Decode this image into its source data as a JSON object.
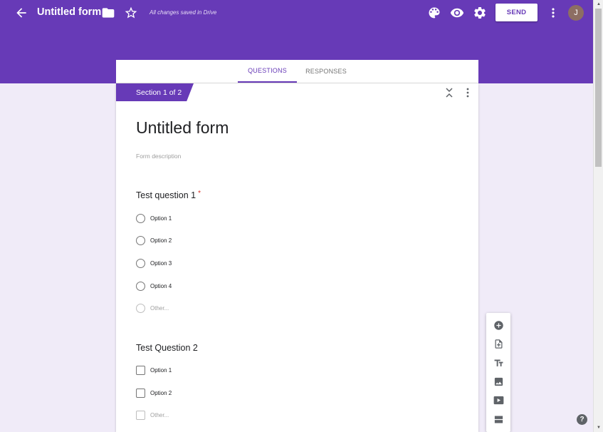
{
  "header": {
    "form_title": "Untitled form",
    "save_status": "All changes saved in Drive",
    "send_label": "SEND",
    "avatar_initial": "J",
    "icons": [
      "back-arrow-icon",
      "folder-icon",
      "star-icon",
      "palette-icon",
      "preview-eye-icon",
      "settings-gear-icon",
      "more-vert-icon"
    ]
  },
  "tabs": [
    {
      "label": "QUESTIONS",
      "active": true
    },
    {
      "label": "RESPONSES",
      "active": false
    }
  ],
  "section": {
    "label": "Section 1 of 2"
  },
  "form": {
    "title": "Untitled form",
    "description_placeholder": "Form description"
  },
  "questions": [
    {
      "title": "Test question 1",
      "required_mark": "*",
      "type": "multiple-choice",
      "options": [
        "Option 1",
        "Option 2",
        "Option 3",
        "Option 4"
      ],
      "other": "Other..."
    },
    {
      "title": "Test Question 2",
      "type": "checkboxes",
      "options": [
        "Option 1",
        "Option 2"
      ],
      "other": "Other..."
    }
  ],
  "toolbar": {
    "icons": [
      "add-question-icon",
      "import-questions-icon",
      "add-title-icon",
      "add-image-icon",
      "add-video-icon",
      "add-section-icon"
    ]
  },
  "help": {
    "label": "?"
  },
  "colors": {
    "accent": "#673ab7",
    "background": "#f0ebf8"
  }
}
